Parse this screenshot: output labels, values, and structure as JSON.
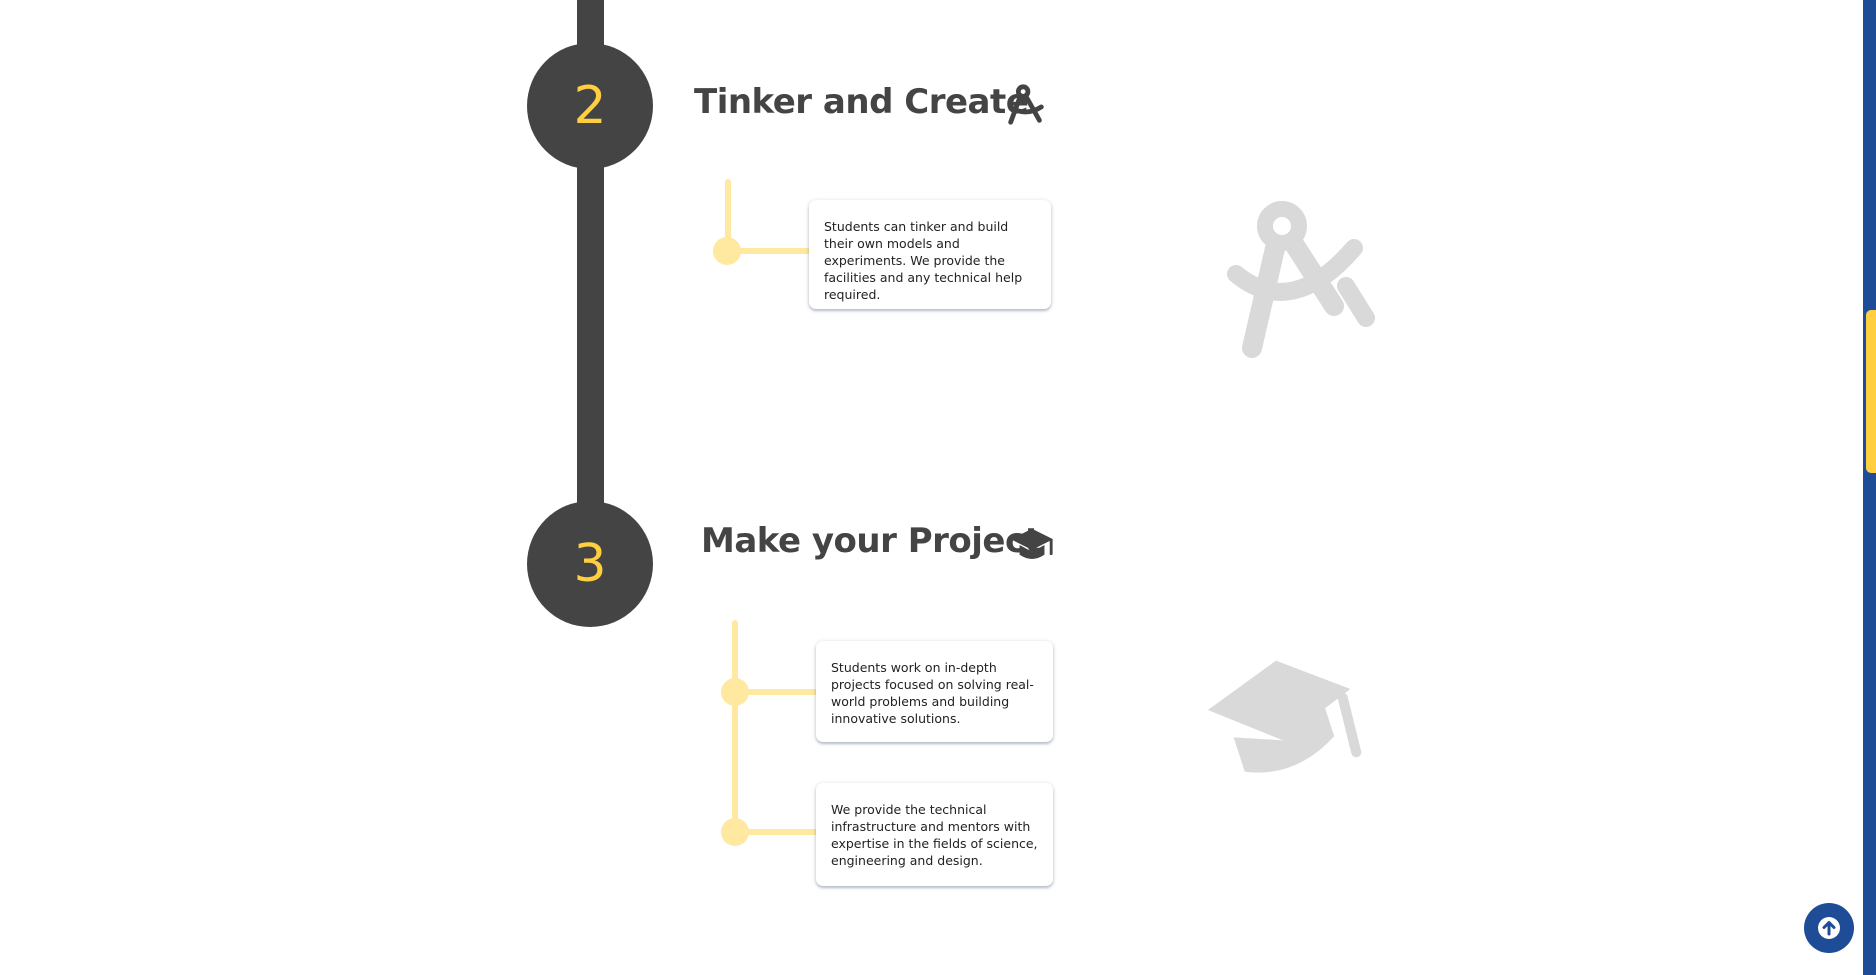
{
  "steps": [
    {
      "number": "2",
      "title": "Tinker and Create",
      "icon": "drafting-compass-icon",
      "cards": [
        "Students can tinker and build their own models and experiments. We provide the facilities and any technical help required."
      ]
    },
    {
      "number": "3",
      "title": "Make your Project",
      "icon": "graduation-cap-icon",
      "cards": [
        "Students work on in-depth projects focused on solving real-world problems and building innovative solutions.",
        "We provide the technical infrastructure and mentors with expertise in the fields of science, engineering and design."
      ]
    }
  ],
  "back_to_top": {
    "icon": "arrow-up-circle-icon"
  },
  "scroll_indicator": {
    "icon": "scroll-thumb"
  },
  "colors": {
    "timeline": "#444444",
    "accent_yellow": "#FFCF40",
    "branch_yellow": "#FFE8A0",
    "brand_blue": "#1E4C96",
    "watermark_grey": "#D9D9D9"
  }
}
